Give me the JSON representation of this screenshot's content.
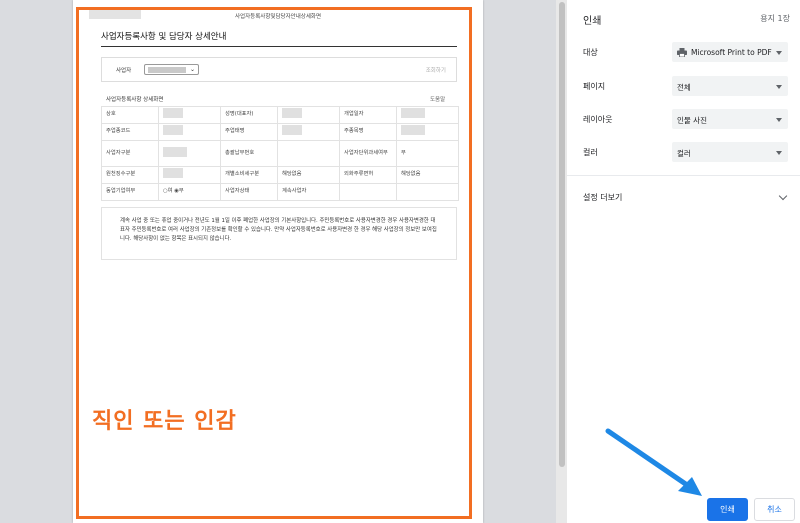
{
  "document": {
    "header_text": "사업자등록사항및담당자안내상세화면",
    "title": "사업자등록사항 및 담당자 상세안내",
    "search": {
      "label": "사업자",
      "button": "조회하기"
    },
    "info_title": "사업자등록사항 상세화면",
    "help": "도움말",
    "rows": [
      {
        "l1": "상호",
        "l2": "성명(대표자)",
        "l3": "개업일자"
      },
      {
        "l1": "주업종코드",
        "l2": "주업태명",
        "l3": "주종목명"
      },
      {
        "l1": "사업자구분",
        "l2": "총괄납부번호",
        "l3": "사업자단위과세여부",
        "v3": "부"
      },
      {
        "l1": "원천징수구분",
        "l2": "개별소비세구분",
        "v2": "해당없음",
        "l3": "외화주류면허",
        "v3": "해당없음"
      },
      {
        "l1": "동업기업여부",
        "v1a": "여",
        "v1b": "부",
        "l2": "사업자상태",
        "v2": "계속사업자"
      }
    ],
    "notice": "계속 사업 중 또는 휴업 중이거나 전년도 1월 1일 이후 폐업한 사업장의 기본사항입니다. 주민등록번호로 사용자변경한 경우 사용자변경한 대표자 주민등록번호로 여러 사업장의 기존정보를 확인할 수 있습니다. 만약 사업자등록번호로 사용자변경 한 경우 해당 사업장의 정보만 보여집니다. 해당사항이 없는 항목은 표시되지 않습니다.",
    "stamp": "직인 또는 인감"
  },
  "panel": {
    "title": "인쇄",
    "sheets": "용지 1장",
    "settings": [
      {
        "label": "대상",
        "value": "Microsoft Print to PDF"
      },
      {
        "label": "페이지",
        "value": "전체"
      },
      {
        "label": "레이아웃",
        "value": "인물 사진"
      },
      {
        "label": "컬러",
        "value": "컬러"
      }
    ],
    "more": "설정 더보기",
    "print_button": "인쇄",
    "cancel_button": "취소"
  },
  "colors": {
    "accent": "#1a73e8",
    "stamp": "#f26e22",
    "arrow": "#1e88e5"
  }
}
